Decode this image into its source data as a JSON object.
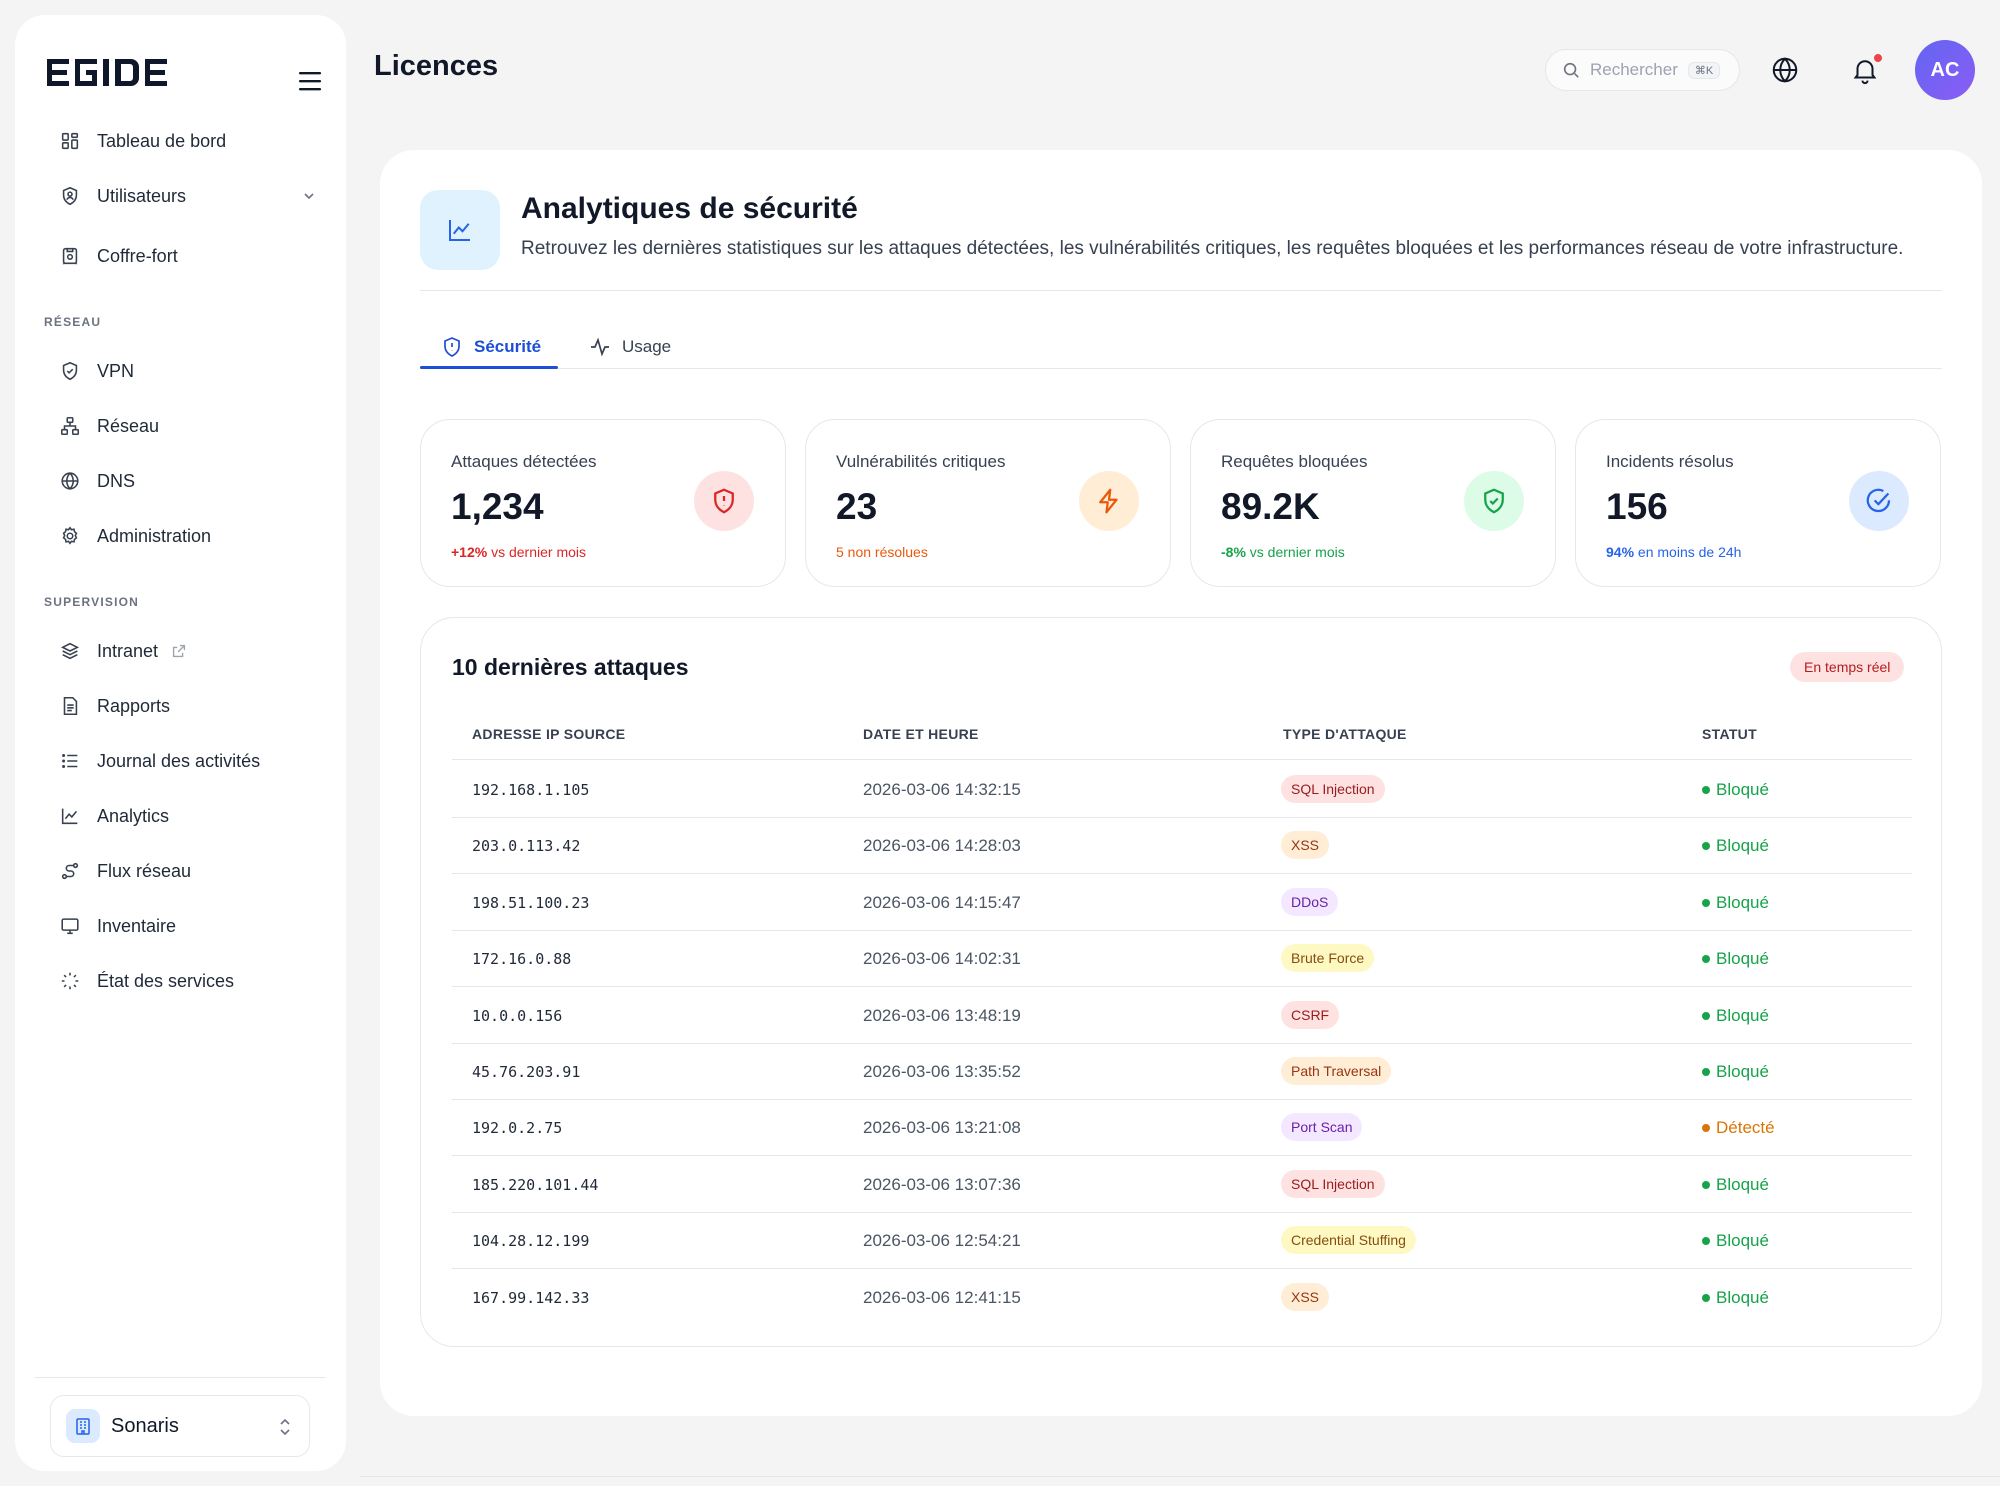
{
  "brand": {
    "name": "EGIDE"
  },
  "sidebar": {
    "items": [
      {
        "label": "Tableau de bord",
        "icon": "dashboard-icon"
      },
      {
        "label": "Utilisateurs",
        "icon": "user-shield-icon",
        "expandable": true
      },
      {
        "label": "Coffre-fort",
        "icon": "vault-icon"
      }
    ],
    "sections": [
      {
        "label": "RÉSEAU",
        "items": [
          {
            "label": "VPN",
            "icon": "shield-icon"
          },
          {
            "label": "Réseau",
            "icon": "network-icon"
          },
          {
            "label": "DNS",
            "icon": "globe-icon"
          },
          {
            "label": "Administration",
            "icon": "gear-icon"
          }
        ]
      },
      {
        "label": "SUPERVISION",
        "items": [
          {
            "label": "Intranet",
            "icon": "layers-icon",
            "external": true
          },
          {
            "label": "Rapports",
            "icon": "report-icon"
          },
          {
            "label": "Journal des activités",
            "icon": "list-icon"
          },
          {
            "label": "Analytics",
            "icon": "chart-line-icon"
          },
          {
            "label": "Flux réseau",
            "icon": "flow-icon"
          },
          {
            "label": "Inventaire",
            "icon": "monitor-icon"
          },
          {
            "label": "État des services",
            "icon": "loader-icon"
          }
        ]
      }
    ],
    "organization": "Sonaris"
  },
  "header": {
    "title": "Licences",
    "search_placeholder": "Rechercher",
    "search_shortcut": "⌘K",
    "avatar_initials": "AC"
  },
  "hero": {
    "title": "Analytiques de sécurité",
    "subtitle": "Retrouvez les dernières statistiques sur les attaques détectées, les vulnérabilités critiques, les requêtes bloquées et les performances réseau de votre infrastructure."
  },
  "tabs": [
    {
      "label": "Sécurité",
      "active": true
    },
    {
      "label": "Usage",
      "active": false
    }
  ],
  "stats": [
    {
      "label": "Attaques détectées",
      "value": "1,234",
      "delta": "+12% vs dernier mois",
      "delta_strong": "+12%",
      "delta_rest": " vs dernier mois",
      "color": "#dc2626",
      "icon_bg": "#fee2e2",
      "icon": "shield-alert-icon"
    },
    {
      "label": "Vulnérabilités critiques",
      "value": "23",
      "delta_strong": "",
      "delta_rest": "5 non résolues",
      "color": "#ea580c",
      "icon_bg": "#ffedd5",
      "icon": "zap-icon"
    },
    {
      "label": "Requêtes bloquées",
      "value": "89.2K",
      "delta_strong": "-8%",
      "delta_rest": " vs dernier mois",
      "color": "#16a34a",
      "icon_bg": "#dcfce7",
      "icon": "shield-check-icon"
    },
    {
      "label": "Incidents résolus",
      "value": "156",
      "delta_strong": "94%",
      "delta_rest": " en moins de 24h",
      "color": "#2563eb",
      "icon_bg": "#dbeafe",
      "icon": "check-circle-icon"
    }
  ],
  "attacks": {
    "title": "10 dernières attaques",
    "badge": "En temps réel",
    "columns": [
      "ADRESSE IP SOURCE",
      "DATE ET HEURE",
      "TYPE D'ATTAQUE",
      "STATUT"
    ],
    "rows": [
      {
        "ip": "192.168.1.105",
        "date": "2026-03-06 14:32:15",
        "type": "SQL Injection",
        "type_bg": "#fee2e2",
        "type_fg": "#991b1b",
        "status": "Bloqué",
        "status_color": "#16a34a"
      },
      {
        "ip": "203.0.113.42",
        "date": "2026-03-06 14:28:03",
        "type": "XSS",
        "type_bg": "#ffedd5",
        "type_fg": "#9a3412",
        "status": "Bloqué",
        "status_color": "#16a34a"
      },
      {
        "ip": "198.51.100.23",
        "date": "2026-03-06 14:15:47",
        "type": "DDoS",
        "type_bg": "#f3e8ff",
        "type_fg": "#6b21a8",
        "status": "Bloqué",
        "status_color": "#16a34a"
      },
      {
        "ip": "172.16.0.88",
        "date": "2026-03-06 14:02:31",
        "type": "Brute Force",
        "type_bg": "#fef9c3",
        "type_fg": "#854d0e",
        "status": "Bloqué",
        "status_color": "#16a34a"
      },
      {
        "ip": "10.0.0.156",
        "date": "2026-03-06 13:48:19",
        "type": "CSRF",
        "type_bg": "#fee2e2",
        "type_fg": "#991b1b",
        "status": "Bloqué",
        "status_color": "#16a34a"
      },
      {
        "ip": "45.76.203.91",
        "date": "2026-03-06 13:35:52",
        "type": "Path Traversal",
        "type_bg": "#ffedd5",
        "type_fg": "#9a3412",
        "status": "Bloqué",
        "status_color": "#16a34a"
      },
      {
        "ip": "192.0.2.75",
        "date": "2026-03-06 13:21:08",
        "type": "Port Scan",
        "type_bg": "#f3e8ff",
        "type_fg": "#6b21a8",
        "status": "Détecté",
        "status_color": "#d97706"
      },
      {
        "ip": "185.220.101.44",
        "date": "2026-03-06 13:07:36",
        "type": "SQL Injection",
        "type_bg": "#fee2e2",
        "type_fg": "#991b1b",
        "status": "Bloqué",
        "status_color": "#16a34a"
      },
      {
        "ip": "104.28.12.199",
        "date": "2026-03-06 12:54:21",
        "type": "Credential Stuffing",
        "type_bg": "#fef9c3",
        "type_fg": "#854d0e",
        "status": "Bloqué",
        "status_color": "#16a34a"
      },
      {
        "ip": "167.99.142.33",
        "date": "2026-03-06 12:41:15",
        "type": "XSS",
        "type_bg": "#ffedd5",
        "type_fg": "#9a3412",
        "status": "Bloqué",
        "status_color": "#16a34a"
      }
    ]
  }
}
